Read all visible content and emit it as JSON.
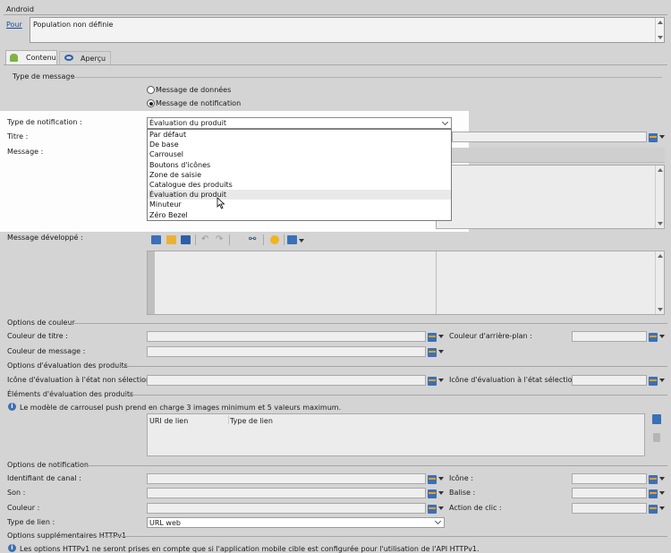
{
  "header": {
    "title": "Android",
    "for_link": "Pour",
    "population": "Population non définie"
  },
  "tabs": [
    {
      "label": "Contenu"
    },
    {
      "label": "Aperçu"
    }
  ],
  "message_type": {
    "section": "Type de message",
    "options": [
      {
        "label": "Message de données",
        "selected": false
      },
      {
        "label": "Message de notification",
        "selected": true
      }
    ]
  },
  "notification": {
    "type_label": "Type de notification :",
    "type_value": "Évaluation du produit",
    "title_label": "Titre :",
    "message_label": "Message :",
    "options": [
      "Par défaut",
      "De base",
      "Carrousel",
      "Boutons d'icônes",
      "Zone de saisie",
      "Catalogue des produits",
      "Évaluation du produit",
      "Minuteur",
      "Zéro Bezel"
    ],
    "highlighted_index": 6
  },
  "expanded_message": {
    "label": "Message développé :"
  },
  "color_options": {
    "section": "Options de couleur",
    "title_color": "Couleur de titre :",
    "message_color": "Couleur de message :",
    "background_color": "Couleur d'arrière-plan :"
  },
  "rating_options": {
    "section": "Options d'évaluation des produits",
    "unselected_icon": "Icône d'évaluation à l'état non sélectionné :",
    "selected_icon": "Icône d'évaluation à l'état sélectionné :"
  },
  "rating_elements": {
    "section": "Éléments d'évaluation des produits",
    "info": "Le modèle de carrousel push prend en charge 3 images minimum et 5 valeurs maximum.",
    "columns": [
      "URI de lien",
      "Type de lien"
    ]
  },
  "notification_options": {
    "section": "Options de notification",
    "channel_id": "Identifiant de canal :",
    "sound": "Son :",
    "color": "Couleur :",
    "link_type": "Type de lien :",
    "link_type_value": "URL web",
    "icon": "Icône :",
    "tag": "Balise :",
    "click_action": "Action de clic :"
  },
  "httpv1": {
    "section": "Options supplémentaires HTTPv1",
    "info": "Les options HTTPv1 ne seront prises en compte que si l'application mobile cible est configurée pour l'utilisation de l'API HTTPv1."
  },
  "colors": {
    "accent": "#3b6fb6",
    "link": "#1a4fa0",
    "highlight": "#ffffff"
  }
}
